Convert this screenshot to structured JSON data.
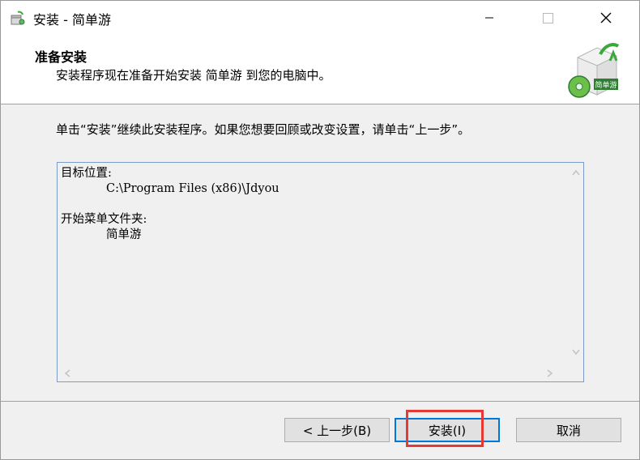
{
  "window": {
    "title": "安装 - 简单游",
    "icons": {
      "app": "installer-box-icon",
      "minimize": "minimize-icon",
      "maximize": "maximize-icon",
      "close": "close-icon"
    }
  },
  "header": {
    "title": "准备安装",
    "subtitle": "安装程序现在准备开始安装 简单游 到您的电脑中。",
    "logo_icon": "installer-logo-icon",
    "logo_text": "简单游"
  },
  "instruction": "单击“安装”继续此安装程序。如果您想要回顾或改变设置，请单击“上一步”。",
  "memo": {
    "dest_label": "目标位置:",
    "dest_value": "C:\\Program Files (x86)\\Jdyou",
    "startmenu_label": "开始菜单文件夹:",
    "startmenu_value": "简单游"
  },
  "buttons": {
    "back": "< 上一步(B)",
    "install": "安装(I)",
    "cancel": "取消"
  },
  "colors": {
    "focus_border": "#0078d7",
    "highlight_box": "#e53935",
    "memo_border": "#7a9cc6"
  }
}
